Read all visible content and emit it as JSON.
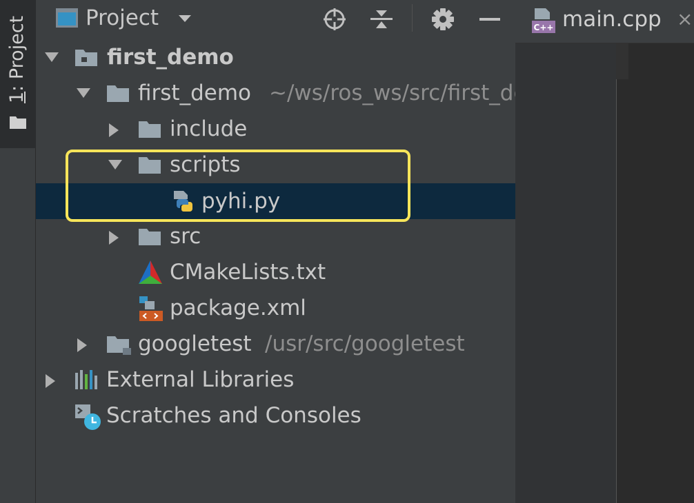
{
  "sidebar": {
    "tab_number": "1",
    "tab_label": ": Project"
  },
  "header": {
    "title": "Project",
    "buttons": [
      "locate-icon",
      "collapse-all-icon",
      "gear-icon",
      "minimize-icon"
    ]
  },
  "tree": [
    {
      "label": "first_demo",
      "path": "",
      "icon": "module-folder-icon",
      "expanded": true
    },
    {
      "label": "first_demo",
      "path": "~/ws/ros_ws/src/first_demo",
      "icon": "folder-icon",
      "expanded": true
    },
    {
      "label": "include",
      "path": "",
      "icon": "folder-icon",
      "expanded": false
    },
    {
      "label": "scripts",
      "path": "",
      "icon": "folder-icon",
      "expanded": true
    },
    {
      "label": "pyhi.py",
      "path": "",
      "icon": "python-file-icon",
      "selected": true
    },
    {
      "label": "src",
      "path": "",
      "icon": "folder-icon",
      "expanded": false
    },
    {
      "label": "CMakeLists.txt",
      "path": "",
      "icon": "cmake-file-icon"
    },
    {
      "label": "package.xml",
      "path": "",
      "icon": "xml-file-icon"
    },
    {
      "label": "googletest",
      "path": "/usr/src/googletest",
      "icon": "folder-icon",
      "expanded": false
    },
    {
      "label": "External Libraries",
      "path": "",
      "icon": "libraries-icon",
      "expanded": false
    },
    {
      "label": "Scratches and Consoles",
      "path": "",
      "icon": "scratches-icon"
    }
  ],
  "editor": {
    "tabs": [
      {
        "label": "main.cpp",
        "icon_text": "C++"
      }
    ]
  },
  "colors": {
    "highlight": "#f7e55a",
    "selected_row": "#0d293e",
    "folder": "#9aa7b0"
  }
}
